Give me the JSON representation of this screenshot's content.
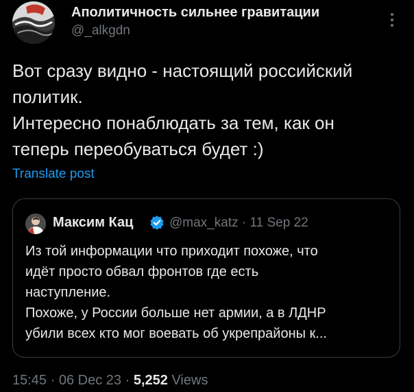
{
  "post": {
    "author": {
      "display_name": "Аполитичность сильнее гравитации",
      "handle": "@_alkgdn"
    },
    "text_lines": [
      "Вот сразу видно - настоящий российский",
      "политик.",
      "Интересно понаблюдать за тем, как он",
      "теперь переобуваться будет :)"
    ],
    "translate_label": "Translate post",
    "more_icon": "more-vertical-icon"
  },
  "quoted_post": {
    "author": {
      "display_name": "Максим Кац",
      "handle": "@max_katz",
      "separator": "·",
      "date": "11 Sep 22",
      "verified_icon": "verified-badge-icon"
    },
    "text_lines": [
      "Из той информации что приходит похоже, что",
      "идёт просто обвал фронтов где есть",
      "наступление.",
      "Похоже, у России больше нет армии, а в ЛДНР",
      "убили всех кто мог воевать об укрепрайоны к..."
    ]
  },
  "meta": {
    "time": "15:45",
    "separator": "·",
    "date": "06 Dec 23",
    "views_count": "5,252",
    "views_label": "Views"
  },
  "colors": {
    "background": "#000000",
    "text_primary": "#e7e9ea",
    "text_secondary": "#71767b",
    "link": "#1d9bf0",
    "border": "#3a3d41",
    "verified": "#1d9bf0"
  }
}
